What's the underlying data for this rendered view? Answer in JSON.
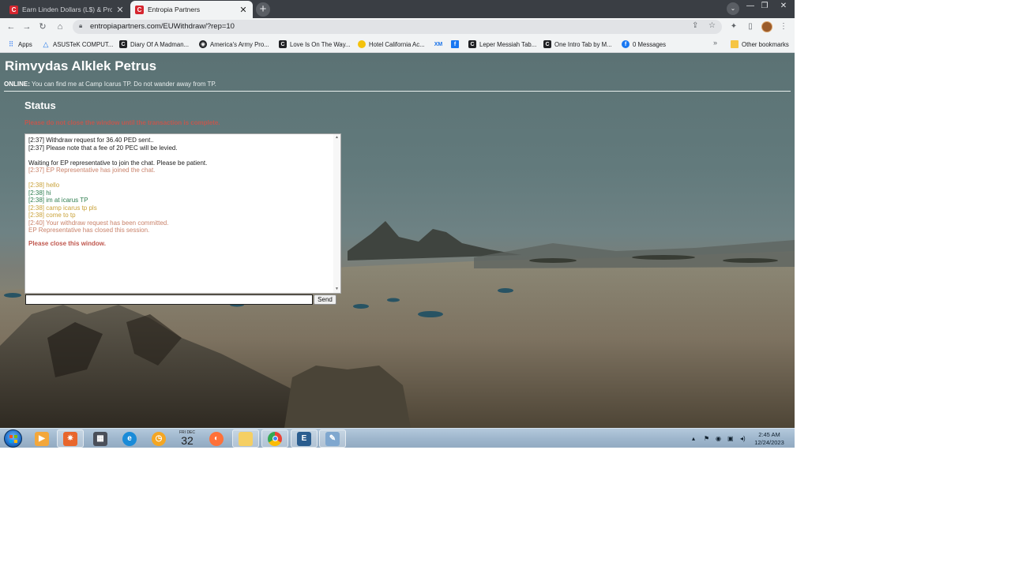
{
  "browser": {
    "tabs": [
      {
        "title": "Earn Linden Dollars (L$) & Projec",
        "active": false
      },
      {
        "title": "Entropia Partners",
        "active": true
      }
    ],
    "url": "entropiapartners.com/EUWithdraw/?rep=10",
    "bookmarks": [
      {
        "label": "Apps",
        "icon": "apps-grid-icon"
      },
      {
        "label": "ASUSTeK COMPUT...",
        "icon": "asus-icon"
      },
      {
        "label": "Diary Of A Madman...",
        "icon": "chordify-icon"
      },
      {
        "label": "America's Army Pro...",
        "icon": "globe-icon"
      },
      {
        "label": "Love Is On The Way...",
        "icon": "chordify-icon"
      },
      {
        "label": "Hotel California Ac...",
        "icon": "hotel-icon"
      },
      {
        "label": "",
        "icon": "xm-icon"
      },
      {
        "label": "",
        "icon": "facebook-square-icon"
      },
      {
        "label": "Leper Messiah Tab...",
        "icon": "chordify-icon"
      },
      {
        "label": "One Intro Tab by M...",
        "icon": "chordify-icon"
      },
      {
        "label": "0 Messages",
        "icon": "facebook-icon"
      }
    ],
    "more_bookmarks": "»",
    "other_bookmarks": "Other bookmarks"
  },
  "page": {
    "profile_name": "Rimvydas Alklek Petrus",
    "online_label": "ONLINE:",
    "online_text": "You can find me at Camp Icarus TP. Do not wander away from TP.",
    "status_heading": "Status",
    "warning": "Please do not close the window until the transaction is complete.",
    "chat": [
      {
        "text": "[2:37] Withdraw request for 36.40 PED sent..",
        "color": "#222222"
      },
      {
        "text": "[2:37] Please note that a fee of 20 PEC will be levied.",
        "color": "#222222"
      },
      {
        "text": "",
        "color": ""
      },
      {
        "text": "Waiting for EP representative to join the chat. Please be patient.",
        "color": "#222222"
      },
      {
        "text": "[2:37] EP Representative has joined the chat.",
        "color": "#c9826a"
      },
      {
        "text": "",
        "color": ""
      },
      {
        "text": "[2:38] hello",
        "color": "#c9a23a"
      },
      {
        "text": "[2:38] hi",
        "color": "#2e7d4f"
      },
      {
        "text": "[2:38] im at icarus TP",
        "color": "#2e7d4f"
      },
      {
        "text": "[2:38] camp icarus tp pls",
        "color": "#c9a23a"
      },
      {
        "text": "[2:38] come to tp",
        "color": "#c9a23a"
      },
      {
        "text": "[2:40] Your withdraw request has been committed.",
        "color": "#c9826a"
      },
      {
        "text": "EP Representative has closed this session.",
        "color": "#c9826a"
      }
    ],
    "close_message": "Please close this window.",
    "message_input_value": "",
    "send_label": "Send"
  },
  "taskbar": {
    "calendar_day": "32",
    "calendar_month": "FRI DEC",
    "time": "2:45 AM",
    "date": "12/24/2023"
  },
  "colors": {
    "warning": "#c0584f",
    "tab_strip": "#3a3e44",
    "browser_chrome": "#f1f3f4"
  }
}
